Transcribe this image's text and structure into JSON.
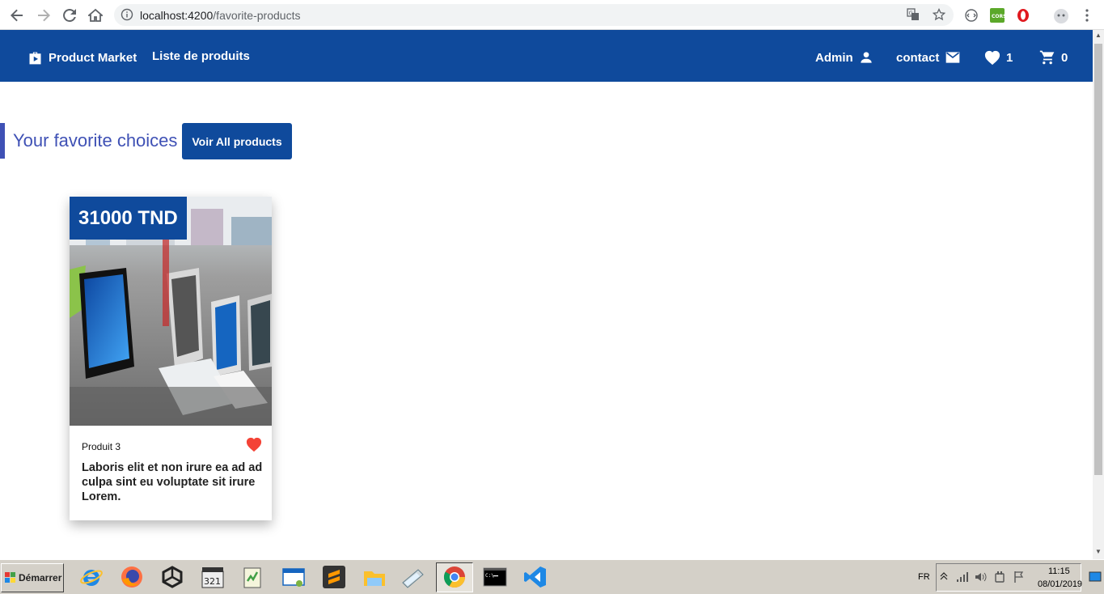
{
  "browser": {
    "url_host": "localhost:4200",
    "url_path": "/favorite-products"
  },
  "navbar": {
    "brand": "Product Market",
    "list_link": "Liste de produits",
    "admin": "Admin",
    "contact": "contact",
    "favorites_count": "1",
    "cart_count": "0"
  },
  "section": {
    "title": "Your favorite choices",
    "button": "Voir All products"
  },
  "product": {
    "price": "31000 TND",
    "name": "Produit 3",
    "description": "Laboris elit et non irure ea ad ad culpa sint eu voluptate sit irure Lorem.",
    "favorite": true
  },
  "taskbar": {
    "start": "Démarrer",
    "lang": "FR",
    "time": "11:15",
    "date": "08/01/2019",
    "icons": [
      "ie-icon",
      "firefox-icon",
      "unity-icon",
      "mpc-icon",
      "notepad-plus-icon",
      "window-app-icon",
      "sublime-icon",
      "file-explorer-icon",
      "edit-app-icon",
      "chrome-icon",
      "cmd-icon",
      "vscode-icon"
    ]
  },
  "colors": {
    "primary": "#0f4a9c",
    "accent": "#3f51b5",
    "heart": "#f44336"
  }
}
